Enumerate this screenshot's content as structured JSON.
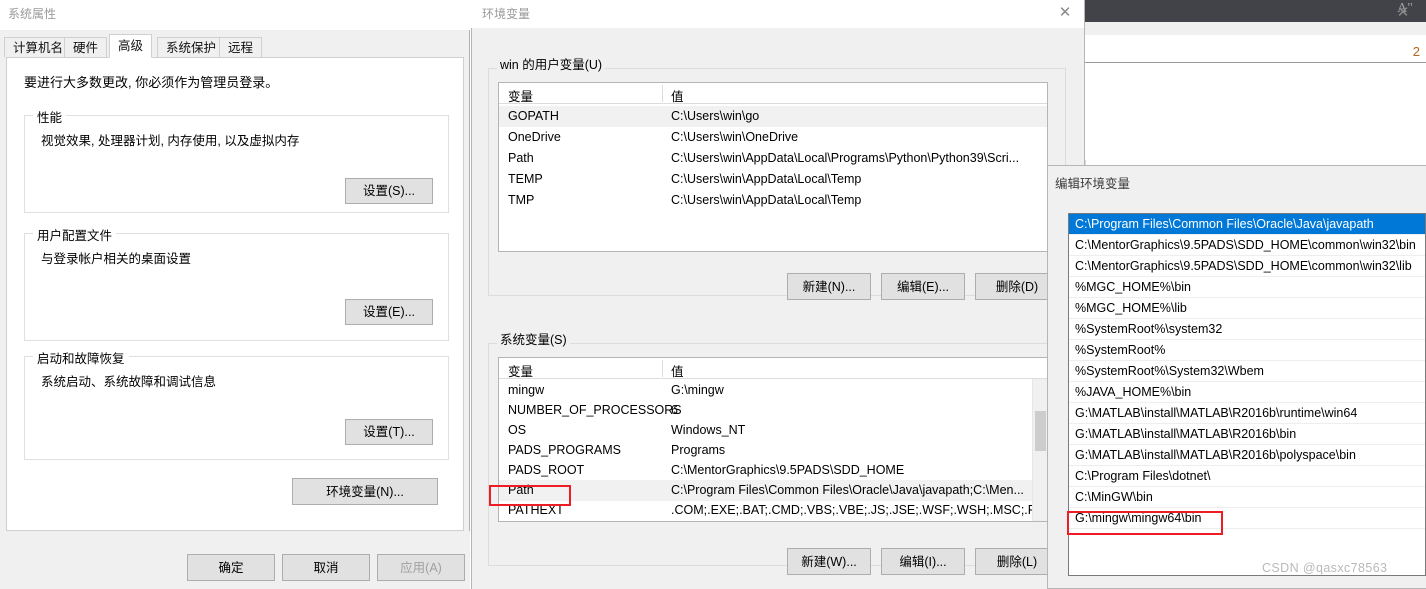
{
  "background_window": {
    "title": "",
    "toolbar_icon": "font-size-icon",
    "row_number": "2"
  },
  "system_properties": {
    "title": "系统属性",
    "close_icon": "✕",
    "tabs": [
      {
        "label": "计算机名",
        "active": false
      },
      {
        "label": "硬件",
        "active": false
      },
      {
        "label": "高级",
        "active": true
      },
      {
        "label": "系统保护",
        "active": false
      },
      {
        "label": "远程",
        "active": false
      }
    ],
    "admin_note": "要进行大多数更改, 你必须作为管理员登录。",
    "groups": [
      {
        "legend": "性能",
        "description": "视觉效果, 处理器计划, 内存使用, 以及虚拟内存",
        "button": "设置(S)..."
      },
      {
        "legend": "用户配置文件",
        "description": "与登录帐户相关的桌面设置",
        "button": "设置(E)..."
      },
      {
        "legend": "启动和故障恢复",
        "description": "系统启动、系统故障和调试信息",
        "button": "设置(T)..."
      }
    ],
    "env_button": "环境变量(N)...",
    "footer_buttons": [
      {
        "label": "确定",
        "disabled": false
      },
      {
        "label": "取消",
        "disabled": false
      },
      {
        "label": "应用(A)",
        "disabled": true
      }
    ]
  },
  "environment_variables": {
    "title": "环境变量",
    "close_icon": "✕",
    "user_section": {
      "legend": "win 的用户变量(U)",
      "columns": [
        "变量",
        "值"
      ],
      "rows": [
        {
          "name": "GOPATH",
          "value": "C:\\Users\\win\\go",
          "selected": true
        },
        {
          "name": "OneDrive",
          "value": "C:\\Users\\win\\OneDrive",
          "selected": false
        },
        {
          "name": "Path",
          "value": "C:\\Users\\win\\AppData\\Local\\Programs\\Python\\Python39\\Scri...",
          "selected": false
        },
        {
          "name": "TEMP",
          "value": "C:\\Users\\win\\AppData\\Local\\Temp",
          "selected": false
        },
        {
          "name": "TMP",
          "value": "C:\\Users\\win\\AppData\\Local\\Temp",
          "selected": false
        }
      ],
      "buttons": [
        "新建(N)...",
        "编辑(E)...",
        "删除(D)"
      ]
    },
    "system_section": {
      "legend": "系统变量(S)",
      "columns": [
        "变量",
        "值"
      ],
      "rows": [
        {
          "name": "mingw",
          "value": "G:\\mingw",
          "selected": false,
          "highlighted": false
        },
        {
          "name": "NUMBER_OF_PROCESSORS",
          "value": "6",
          "selected": false,
          "highlighted": false
        },
        {
          "name": "OS",
          "value": "Windows_NT",
          "selected": false,
          "highlighted": false
        },
        {
          "name": "PADS_PROGRAMS",
          "value": "Programs",
          "selected": false,
          "highlighted": false
        },
        {
          "name": "PADS_ROOT",
          "value": "C:\\MentorGraphics\\9.5PADS\\SDD_HOME",
          "selected": false,
          "highlighted": false
        },
        {
          "name": "Path",
          "value": "C:\\Program Files\\Common Files\\Oracle\\Java\\javapath;C:\\Men...",
          "selected": true,
          "highlighted": true
        },
        {
          "name": "PATHEXT",
          "value": ".COM;.EXE;.BAT;.CMD;.VBS;.VBE;.JS;.JSE;.WSF;.WSH;.MSC;.PY;.P...",
          "selected": false,
          "highlighted": false
        }
      ],
      "buttons": [
        "新建(W)...",
        "编辑(I)...",
        "删除(L)"
      ]
    }
  },
  "edit_environment_variable": {
    "title": "编辑环境变量",
    "entries": [
      {
        "path": "C:\\Program Files\\Common Files\\Oracle\\Java\\javapath",
        "selected": true,
        "highlighted": false
      },
      {
        "path": "C:\\MentorGraphics\\9.5PADS\\SDD_HOME\\common\\win32\\bin",
        "selected": false,
        "highlighted": false
      },
      {
        "path": "C:\\MentorGraphics\\9.5PADS\\SDD_HOME\\common\\win32\\lib",
        "selected": false,
        "highlighted": false
      },
      {
        "path": "%MGC_HOME%\\bin",
        "selected": false,
        "highlighted": false
      },
      {
        "path": "%MGC_HOME%\\lib",
        "selected": false,
        "highlighted": false
      },
      {
        "path": "%SystemRoot%\\system32",
        "selected": false,
        "highlighted": false
      },
      {
        "path": "%SystemRoot%",
        "selected": false,
        "highlighted": false
      },
      {
        "path": "%SystemRoot%\\System32\\Wbem",
        "selected": false,
        "highlighted": false
      },
      {
        "path": "%JAVA_HOME%\\bin",
        "selected": false,
        "highlighted": false
      },
      {
        "path": "G:\\MATLAB\\install\\MATLAB\\R2016b\\runtime\\win64",
        "selected": false,
        "highlighted": false
      },
      {
        "path": "G:\\MATLAB\\install\\MATLAB\\R2016b\\bin",
        "selected": false,
        "highlighted": false
      },
      {
        "path": "G:\\MATLAB\\install\\MATLAB\\R2016b\\polyspace\\bin",
        "selected": false,
        "highlighted": false
      },
      {
        "path": "C:\\Program Files\\dotnet\\",
        "selected": false,
        "highlighted": false
      },
      {
        "path": "C:\\MinGW\\bin",
        "selected": false,
        "highlighted": false
      },
      {
        "path": "G:\\mingw\\mingw64\\bin",
        "selected": false,
        "highlighted": true
      }
    ]
  },
  "annotations": {
    "accent_color": "#ee1c25",
    "selection_color": "#0078d7"
  },
  "watermark": "CSDN @qasxc78563"
}
